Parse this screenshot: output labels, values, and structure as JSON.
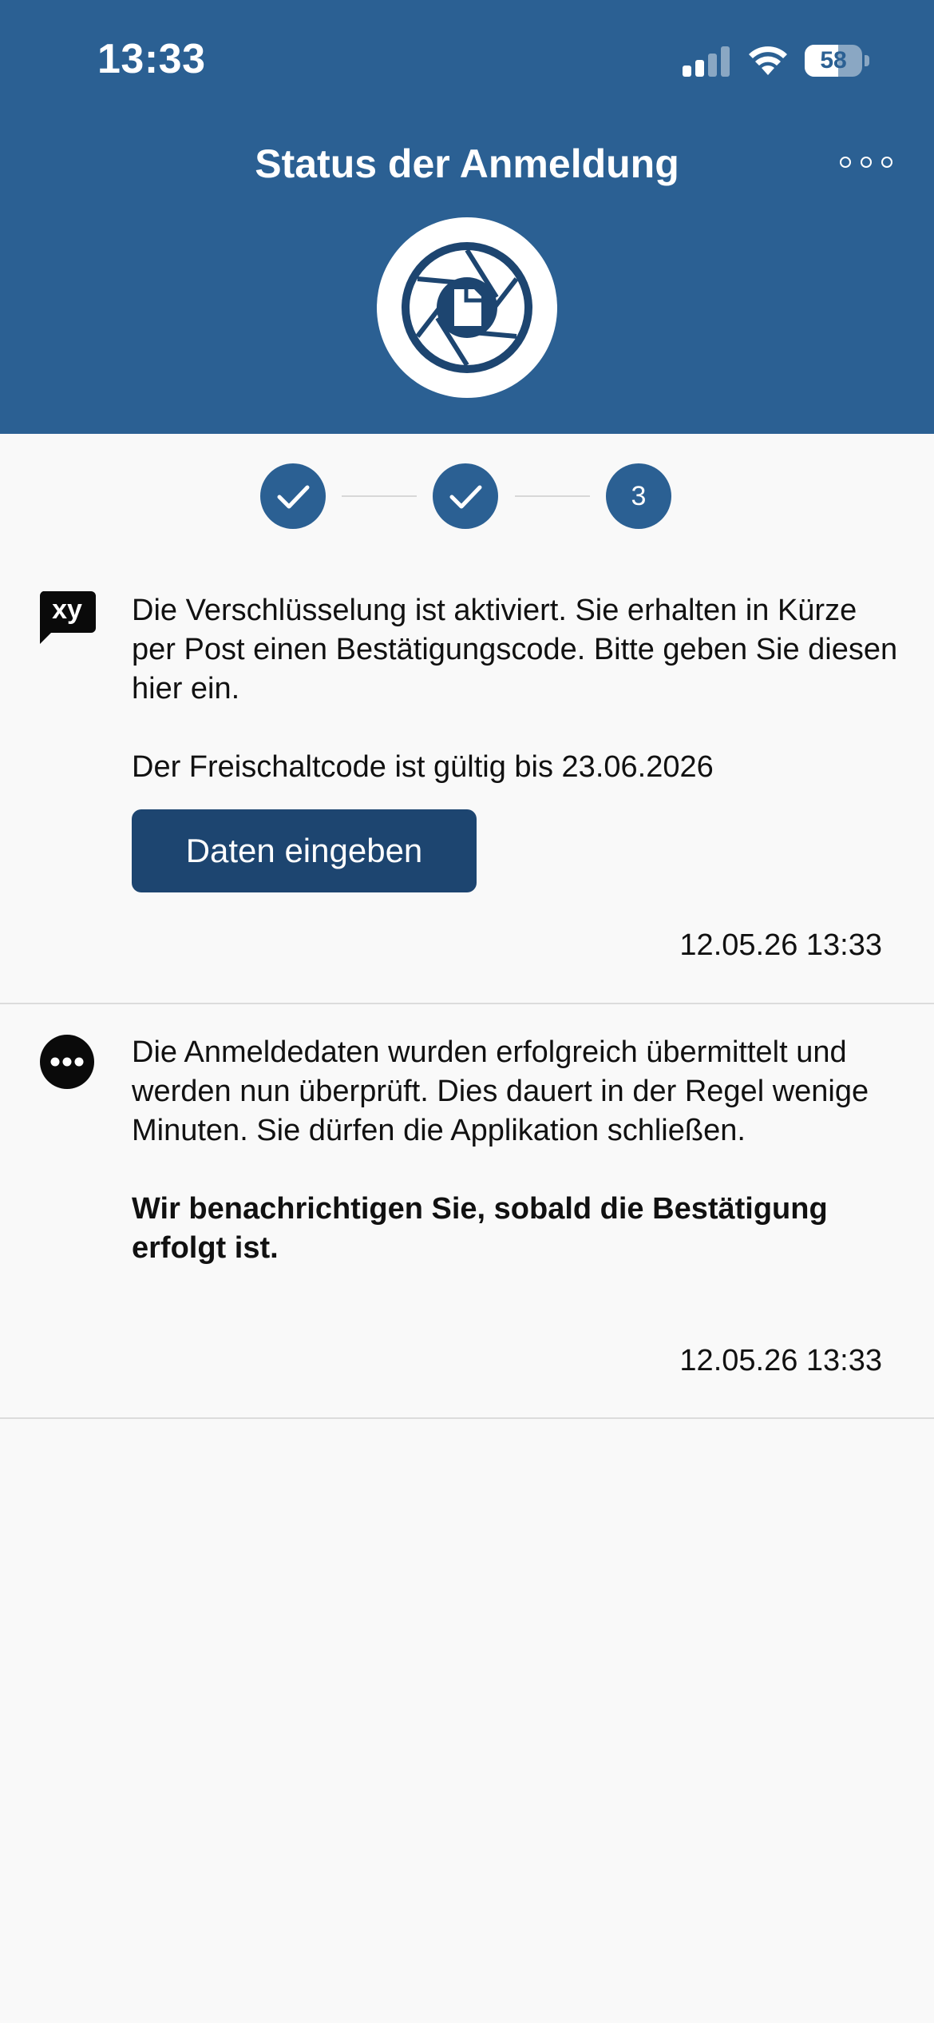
{
  "status_bar": {
    "time": "13:33",
    "battery": "58",
    "battery_level": 0.58
  },
  "header": {
    "title": "Status der Anmeldung",
    "more_icon": "ellipsis-icon",
    "logo_icon": "shutter-logo-icon"
  },
  "stepper": {
    "steps": [
      {
        "state": "done",
        "label": ""
      },
      {
        "state": "done",
        "label": ""
      },
      {
        "state": "current",
        "label": "3"
      }
    ]
  },
  "messages": [
    {
      "icon": "xy-chat-icon",
      "icon_label": "xy",
      "paragraphs": [
        "Die Verschlüsselung ist aktiviert. Sie erhalten in Kürze per Post einen Bestätigungscode. Bitte geben Sie diesen hier ein.",
        "Der Freischaltcode ist gültig bis 23.06.2026"
      ],
      "button_label": "Daten eingeben",
      "timestamp": "12.05.26 13:33"
    },
    {
      "icon": "ellipsis-circle-icon",
      "paragraphs": [
        "Die Anmeldedaten wurden erfolgreich übermittelt und werden nun überprüft. Dies dauert in der Regel wenige Minuten. Sie dürfen die Applikation schließen.",
        "Wir benachrichtigen Sie, sobald die Bestätigung erfolgt ist."
      ],
      "timestamp": "12.05.26 13:33"
    }
  ],
  "colors": {
    "header_bg": "#2b6093",
    "button_bg": "#1d4570",
    "page_bg": "#f9f9f9"
  }
}
